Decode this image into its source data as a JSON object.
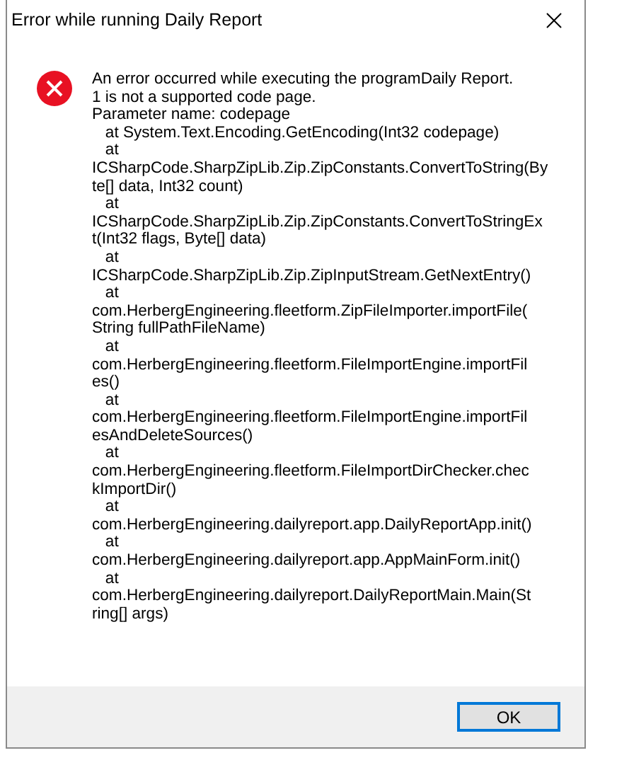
{
  "window": {
    "title": "Error while running Daily Report"
  },
  "message_lines": [
    "An error occurred while executing the programDaily Report.",
    "1 is not a supported code page.",
    "Parameter name: codepage",
    "   at System.Text.Encoding.GetEncoding(Int32 codepage)",
    "   at",
    "ICSharpCode.SharpZipLib.Zip.ZipConstants.ConvertToString(By",
    "te[] data, Int32 count)",
    "   at",
    "ICSharpCode.SharpZipLib.Zip.ZipConstants.ConvertToStringEx",
    "t(Int32 flags, Byte[] data)",
    "   at",
    "ICSharpCode.SharpZipLib.Zip.ZipInputStream.GetNextEntry()",
    "   at",
    "com.HerbergEngineering.fleetform.ZipFileImporter.importFile(",
    "String fullPathFileName)",
    "   at",
    "com.HerbergEngineering.fleetform.FileImportEngine.importFil",
    "es()",
    "   at",
    "com.HerbergEngineering.fleetform.FileImportEngine.importFil",
    "esAndDeleteSources()",
    "   at",
    "com.HerbergEngineering.fleetform.FileImportDirChecker.chec",
    "kImportDir()",
    "   at",
    "com.HerbergEngineering.dailyreport.app.DailyReportApp.init()",
    "   at",
    "com.HerbergEngineering.dailyreport.app.AppMainForm.init()",
    "   at",
    "com.HerbergEngineering.dailyreport.DailyReportMain.Main(St",
    "ring[] args)"
  ],
  "buttons": [
    "OK"
  ]
}
